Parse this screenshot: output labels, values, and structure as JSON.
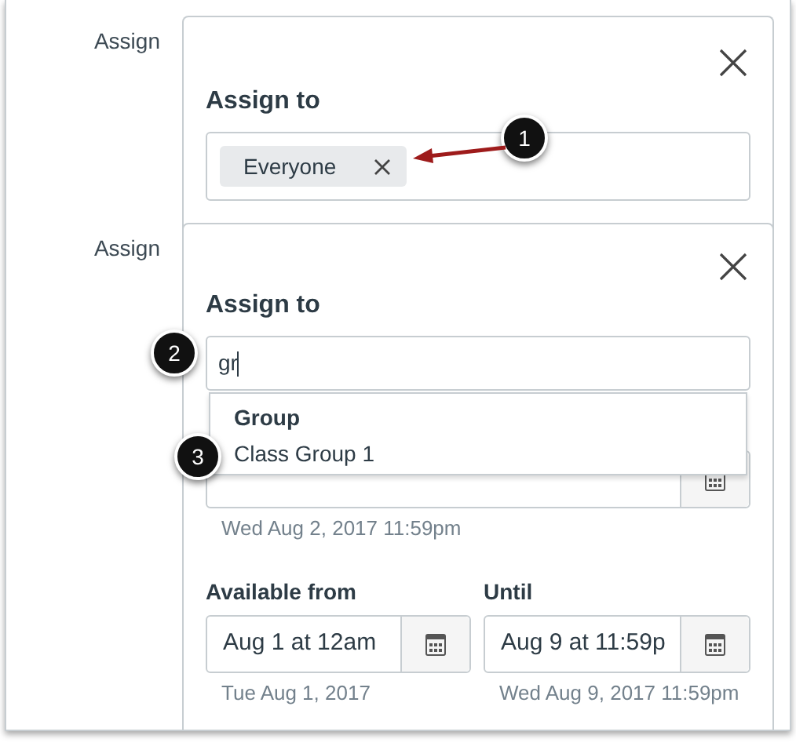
{
  "sections": [
    {
      "label": "Assign",
      "heading": "Assign to",
      "tokens": [
        "Everyone"
      ]
    },
    {
      "label": "Assign",
      "heading": "Assign to",
      "input_value": "gr",
      "dropdown": {
        "group_label": "Group",
        "options": [
          "Class Group 1"
        ]
      },
      "due": {
        "hint": "Wed Aug 2, 2017 11:59pm"
      },
      "availability": [
        {
          "label": "Available from",
          "value": "Aug 1 at 12am",
          "hint": "Tue Aug 1, 2017"
        },
        {
          "label": "Until",
          "value": "Aug 9 at 11:59p",
          "hint": "Wed Aug 9, 2017 11:59pm"
        }
      ]
    }
  ],
  "callouts": [
    "1",
    "2",
    "3"
  ]
}
